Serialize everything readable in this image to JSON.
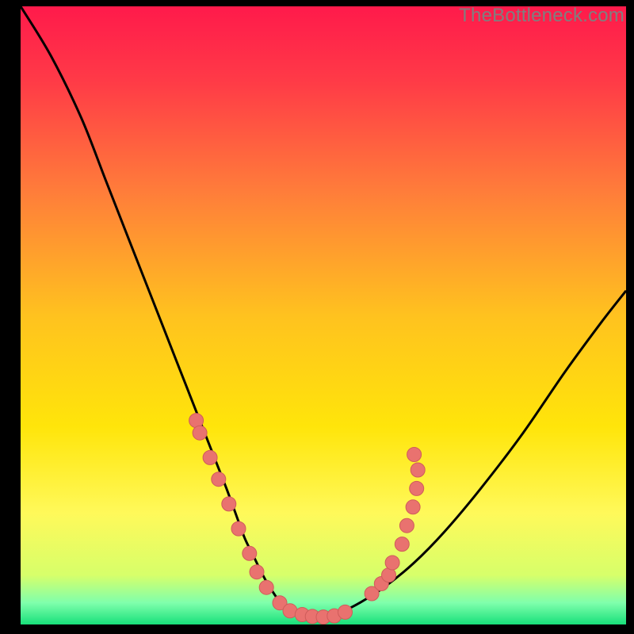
{
  "watermark": "TheBottleneck.com",
  "colors": {
    "bg_black": "#000000",
    "grad_top": "#ff1a4b",
    "grad_mid": "#ffd400",
    "grad_low": "#ffff66",
    "grad_green": "#18e07a",
    "curve": "#000000",
    "dot_fill": "#e9726f",
    "dot_stroke": "#cf5c5a",
    "watermark": "#7f7f7f"
  },
  "chart_data": {
    "type": "line",
    "title": "",
    "xlabel": "",
    "ylabel": "",
    "xlim": [
      0,
      100
    ],
    "ylim": [
      0,
      100
    ],
    "grid": false,
    "legend": false,
    "series": [
      {
        "name": "bottleneck-curve",
        "x": [
          0,
          5,
          10,
          14,
          18,
          22,
          26,
          28,
          30,
          32,
          34,
          35.5,
          37,
          38.5,
          40,
          41.5,
          43,
          45,
          47,
          49,
          51,
          53,
          56,
          60,
          65,
          70,
          76,
          83,
          90,
          96,
          100
        ],
        "y": [
          100,
          92,
          82,
          72,
          62,
          52,
          42,
          37,
          32,
          27,
          22,
          18,
          14,
          11,
          8,
          5.5,
          3.5,
          2,
          1.2,
          1,
          1.2,
          2,
          3.5,
          6,
          10,
          15,
          22,
          31,
          41,
          49,
          54
        ]
      }
    ],
    "scatter": [
      {
        "name": "left-cluster",
        "points": [
          {
            "x": 29.0,
            "y": 33.0
          },
          {
            "x": 29.6,
            "y": 31.0
          },
          {
            "x": 31.3,
            "y": 27.0
          },
          {
            "x": 32.7,
            "y": 23.5
          },
          {
            "x": 34.4,
            "y": 19.5
          },
          {
            "x": 36.0,
            "y": 15.5
          },
          {
            "x": 37.8,
            "y": 11.5
          },
          {
            "x": 39.0,
            "y": 8.5
          },
          {
            "x": 40.6,
            "y": 6.0
          },
          {
            "x": 42.8,
            "y": 3.5
          }
        ]
      },
      {
        "name": "valley-floor",
        "points": [
          {
            "x": 44.5,
            "y": 2.2
          },
          {
            "x": 46.5,
            "y": 1.6
          },
          {
            "x": 48.2,
            "y": 1.3
          },
          {
            "x": 50.0,
            "y": 1.2
          },
          {
            "x": 51.8,
            "y": 1.4
          },
          {
            "x": 53.6,
            "y": 2.0
          }
        ]
      },
      {
        "name": "right-cluster",
        "points": [
          {
            "x": 58.0,
            "y": 5.0
          },
          {
            "x": 59.6,
            "y": 6.6
          },
          {
            "x": 60.8,
            "y": 8.0
          },
          {
            "x": 61.4,
            "y": 10.0
          },
          {
            "x": 63.0,
            "y": 13.0
          },
          {
            "x": 63.8,
            "y": 16.0
          },
          {
            "x": 64.8,
            "y": 19.0
          },
          {
            "x": 65.4,
            "y": 22.0
          },
          {
            "x": 65.6,
            "y": 25.0
          },
          {
            "x": 65.0,
            "y": 27.5
          }
        ]
      }
    ],
    "background_gradient_stops": [
      {
        "offset": 0.0,
        "color": "#ff1a4b"
      },
      {
        "offset": 0.12,
        "color": "#ff3a47"
      },
      {
        "offset": 0.3,
        "color": "#ff7d3a"
      },
      {
        "offset": 0.5,
        "color": "#ffc21f"
      },
      {
        "offset": 0.68,
        "color": "#ffe50a"
      },
      {
        "offset": 0.82,
        "color": "#fff95a"
      },
      {
        "offset": 0.92,
        "color": "#d7ff6a"
      },
      {
        "offset": 0.965,
        "color": "#7fffac"
      },
      {
        "offset": 1.0,
        "color": "#18e07a"
      }
    ]
  }
}
